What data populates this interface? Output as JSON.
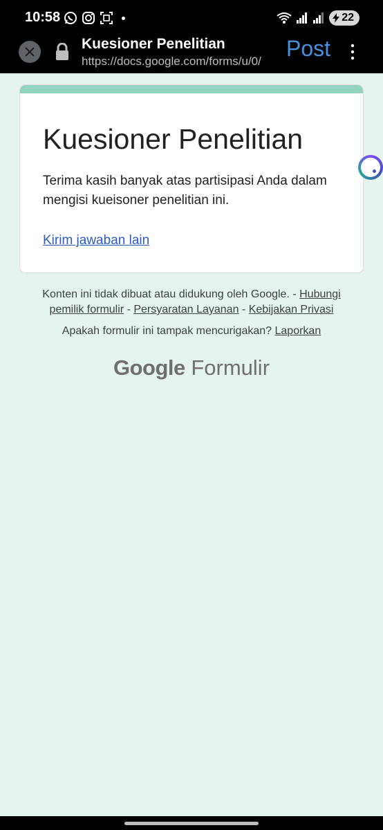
{
  "status_bar": {
    "time": "10:58",
    "battery": "22",
    "icons_left": [
      "whatsapp-icon",
      "instagram-icon",
      "screenshot-icon"
    ],
    "icons_right": [
      "wifi-icon",
      "signal-icon-1",
      "signal-icon-2",
      "battery-icon"
    ]
  },
  "toolbar": {
    "title": "Kuesioner Penelitian",
    "url": "https://docs.google.com/forms/u/0/",
    "post_label": "Post"
  },
  "card": {
    "title": "Kuesioner Penelitian",
    "message": "Terima kasih banyak atas partisipasi Anda dalam mengisi kueisoner penelitian ini.",
    "link_label": "Kirim jawaban lain",
    "accent_color": "#93d3c1"
  },
  "footer": {
    "disclaimer": "Konten ini tidak dibuat atau didukung oleh Google. -",
    "contact_link": "Hubungi pemilik formulir",
    "sep1": "-",
    "terms_link": "Persyaratan Layanan",
    "sep2": "-",
    "privacy_link": "Kebijakan Privasi",
    "report_question": "Apakah formulir ini tampak mencurigakan?",
    "report_link": "Laporkan"
  },
  "logo": {
    "brand": "Google",
    "product": "Formulir"
  },
  "colors": {
    "background": "#e6f4f0",
    "link": "#2b5bbd",
    "post": "#4a90e2"
  }
}
